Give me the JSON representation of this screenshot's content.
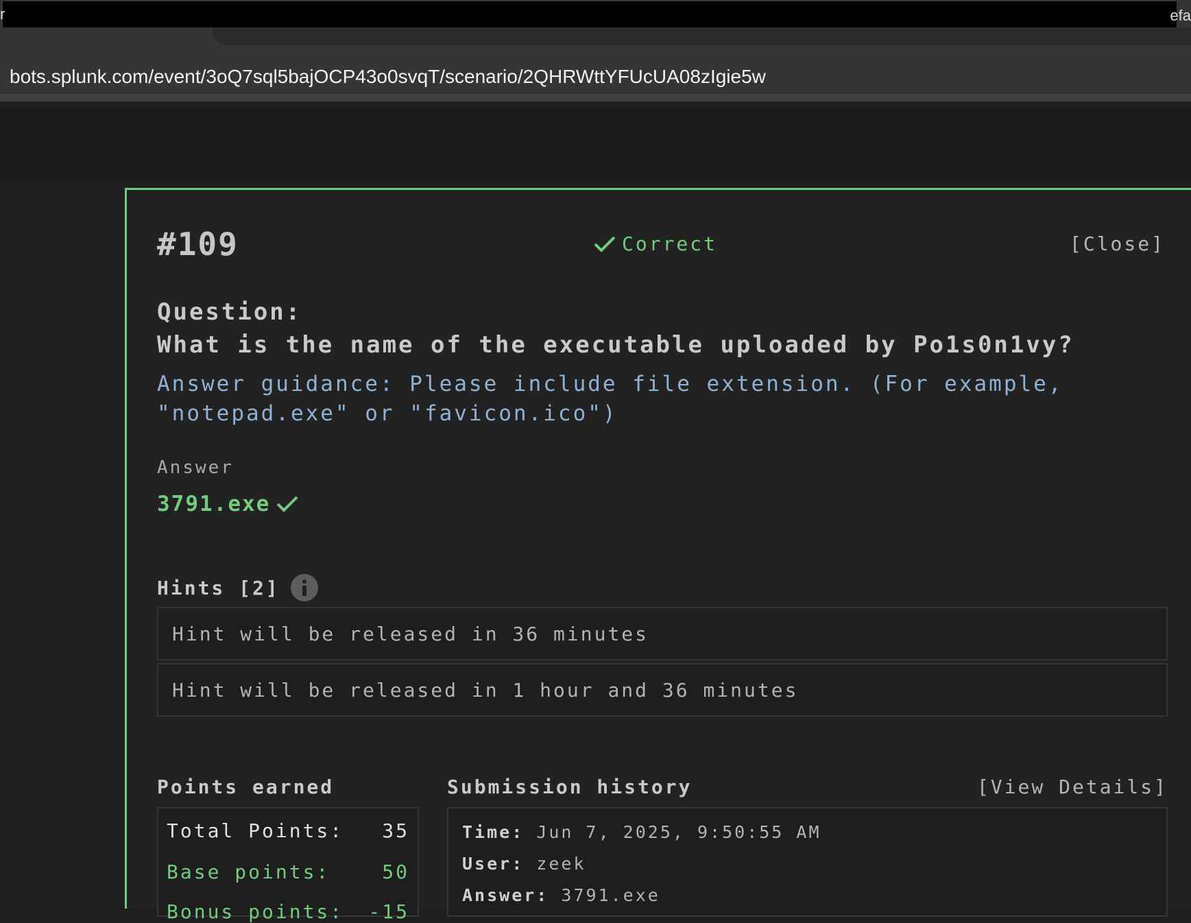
{
  "browser": {
    "left_edge_char": "r",
    "right_edge_text": "efa",
    "url": "bots.splunk.com/event/3oQ7sql5bajOCP43o0svqT/scenario/2QHRWttYFUcUA08zIgie5w"
  },
  "question": {
    "number": "#109",
    "status": "Correct",
    "close_label": "[Close]",
    "label": "Question:",
    "text": "What is the name of the executable uploaded by Po1s0n1vy?",
    "guidance": "Answer guidance: Please include file extension. (For example, \"notepad.exe\" or \"favicon.ico\")"
  },
  "answer": {
    "label": "Answer",
    "value": "3791.exe"
  },
  "hints": {
    "label": "Hints [2]",
    "items": [
      "Hint will be released in 36 minutes",
      "Hint will be released in 1 hour and 36 minutes"
    ]
  },
  "points": {
    "label": "Points earned",
    "total_label": "Total Points:",
    "total_value": "35",
    "base_label": "Base points:",
    "base_value": "50",
    "bonus_label": "Bonus points:",
    "bonus_value": "-15"
  },
  "history": {
    "label": "Submission history",
    "view_details_label": "[View Details]",
    "time_label": "Time:",
    "time_value": "Jun 7, 2025, 9:50:55 AM",
    "user_label": "User:",
    "user_value": "zeek",
    "answer_label": "Answer:",
    "answer_value": "3791.exe"
  },
  "colors": {
    "accent_green": "#72cc7e",
    "guidance_blue": "#8fb2d4",
    "panel_border": "#6fcf7f"
  }
}
